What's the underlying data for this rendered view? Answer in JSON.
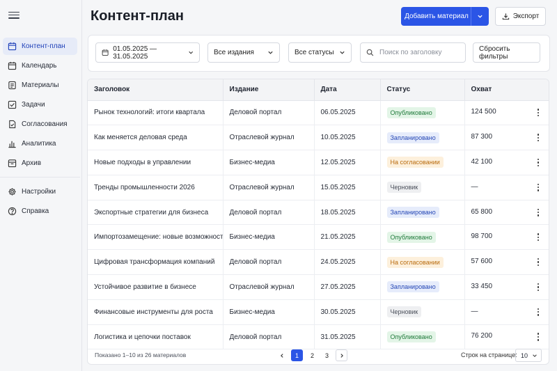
{
  "sidebar": {
    "items": [
      {
        "label": "Контент-план",
        "icon": "calendar-list-icon",
        "active": true
      },
      {
        "label": "Календарь",
        "icon": "calendar-icon"
      },
      {
        "label": "Материалы",
        "icon": "document-icon"
      },
      {
        "label": "Задачи",
        "icon": "checkbox-icon"
      },
      {
        "label": "Согласования",
        "icon": "approval-icon"
      },
      {
        "label": "Аналитика",
        "icon": "bar-chart-icon"
      },
      {
        "label": "Архив",
        "icon": "archive-icon"
      }
    ],
    "bottom_items": [
      {
        "label": "Настройки",
        "icon": "gear-icon"
      },
      {
        "label": "Справка",
        "icon": "help-icon"
      }
    ]
  },
  "header": {
    "title": "Контент-план",
    "add_button": "Добавить материал",
    "export_button": "Экспорт"
  },
  "filters": {
    "date_range": "01.05.2025 — 31.05.2025",
    "publication": "Все издания",
    "status": "Все статусы",
    "search_placeholder": "Поиск по заголовку",
    "reset": "Сбросить фильтры"
  },
  "table": {
    "columns": [
      "Заголовок",
      "Издание",
      "Дата",
      "Статус",
      "Охват"
    ],
    "rows": [
      {
        "title": "Рынок технологий: итоги квартала",
        "pub": "Деловой портал",
        "date": "06.05.2025",
        "status": "Опубликовано",
        "reach": "124 500"
      },
      {
        "title": "Как меняется деловая среда",
        "pub": "Отраслевой журнал",
        "date": "10.05.2025",
        "status": "Запланировано",
        "reach": "87 300"
      },
      {
        "title": "Новые подходы в управлении",
        "pub": "Бизнес-медиа",
        "date": "12.05.2025",
        "status": "На согласовании",
        "reach": "42 100"
      },
      {
        "title": "Тренды промышленности 2026",
        "pub": "Отраслевой журнал",
        "date": "15.05.2025",
        "status": "Черновик",
        "reach": "—"
      },
      {
        "title": "Экспортные стратегии для бизнеса",
        "pub": "Деловой портал",
        "date": "18.05.2025",
        "status": "Запланировано",
        "reach": "65 800"
      },
      {
        "title": "Импортозамещение: новые возможности",
        "pub": "Бизнес-медиа",
        "date": "21.05.2025",
        "status": "Опубликовано",
        "reach": "98 700"
      },
      {
        "title": "Цифровая трансформация компаний",
        "pub": "Деловой портал",
        "date": "24.05.2025",
        "status": "На согласовании",
        "reach": "57 600"
      },
      {
        "title": "Устойчивое развитие в бизнесе",
        "pub": "Отраслевой журнал",
        "date": "27.05.2025",
        "status": "Запланировано",
        "reach": "33 450"
      },
      {
        "title": "Финансовые инструменты для роста",
        "pub": "Бизнес-медиа",
        "date": "30.05.2025",
        "status": "Черновик",
        "reach": "—"
      },
      {
        "title": "Логистика и цепочки поставок",
        "pub": "Деловой портал",
        "date": "31.05.2025",
        "status": "Опубликовано",
        "reach": "76 200"
      }
    ]
  },
  "status_colors": {
    "Опубликовано": {
      "bg": "#e3f5e7",
      "fg": "#1f7a3a"
    },
    "Запланировано": {
      "bg": "#e6ecfb",
      "fg": "#2446b5"
    },
    "На согласовании": {
      "bg": "#fdf0dc",
      "fg": "#b86a0c"
    },
    "Черновик": {
      "bg": "#eeeff1",
      "fg": "#4a4f5a"
    }
  },
  "pagination": {
    "info": "Показано 1–10 из 26 материалов",
    "pages": [
      "1",
      "2",
      "3"
    ],
    "current": "1",
    "rows_label": "Строк на странице:",
    "rows_value": "10"
  },
  "colors": {
    "accent": "#2b55e6"
  }
}
